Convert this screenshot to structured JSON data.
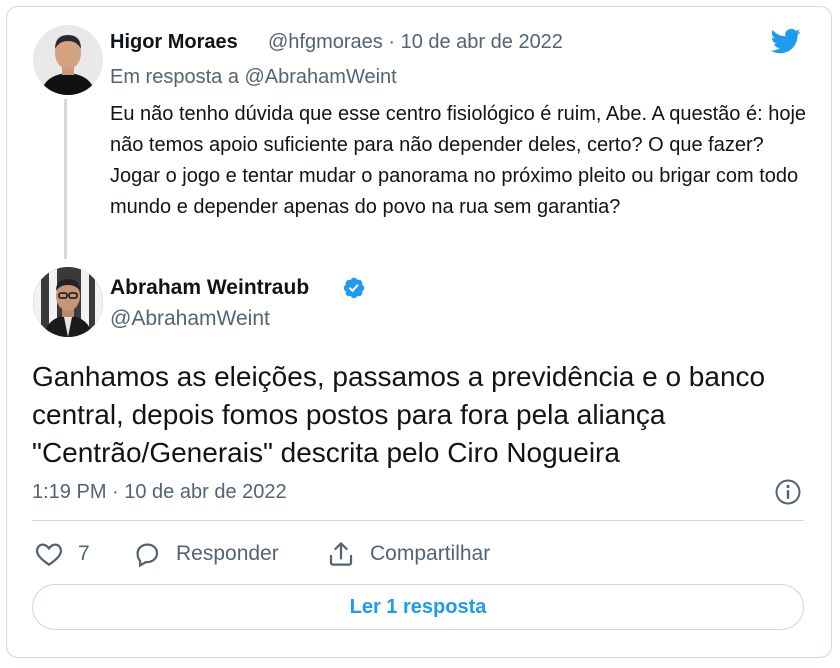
{
  "colors": {
    "accent": "#1d9bf0",
    "text_primary": "#0f1419",
    "text_secondary": "#536471",
    "border": "#cfd9de"
  },
  "icons": {
    "brand": "twitter-bird-icon",
    "verified": "verified-badge-icon",
    "info": "info-icon",
    "like": "heart-icon",
    "reply": "speech-bubble-icon",
    "share": "share-icon"
  },
  "reply_tweet": {
    "author_name": "Higor Moraes",
    "meta": "@hfgmoraes · 10 de abr de 2022",
    "in_reply_to": "Em resposta a @AbrahamWeint",
    "text": "Eu não tenho dúvida que esse centro fisiológico é ruim, Abe. A questão é: hoje não temos apoio suficiente para não depender deles, certo? O que fazer? Jogar o jogo e tentar mudar o panorama no próximo pleito ou brigar com todo mundo e depender apenas do povo na rua sem garantia?"
  },
  "main_tweet": {
    "author_name": "Abraham Weintraub",
    "handle": "@AbrahamWeint",
    "text": "Ganhamos as eleições, passamos a previdência e o banco central, depois fomos postos para fora pela aliança \"Centrão/Generais\" descrita pelo Ciro Nogueira",
    "timestamp": "1:19 PM · 10 de abr de 2022"
  },
  "actions": {
    "like_count": "7",
    "reply_label": "Responder",
    "share_label": "Compartilhar"
  },
  "read_replies_label": "Ler 1 resposta"
}
